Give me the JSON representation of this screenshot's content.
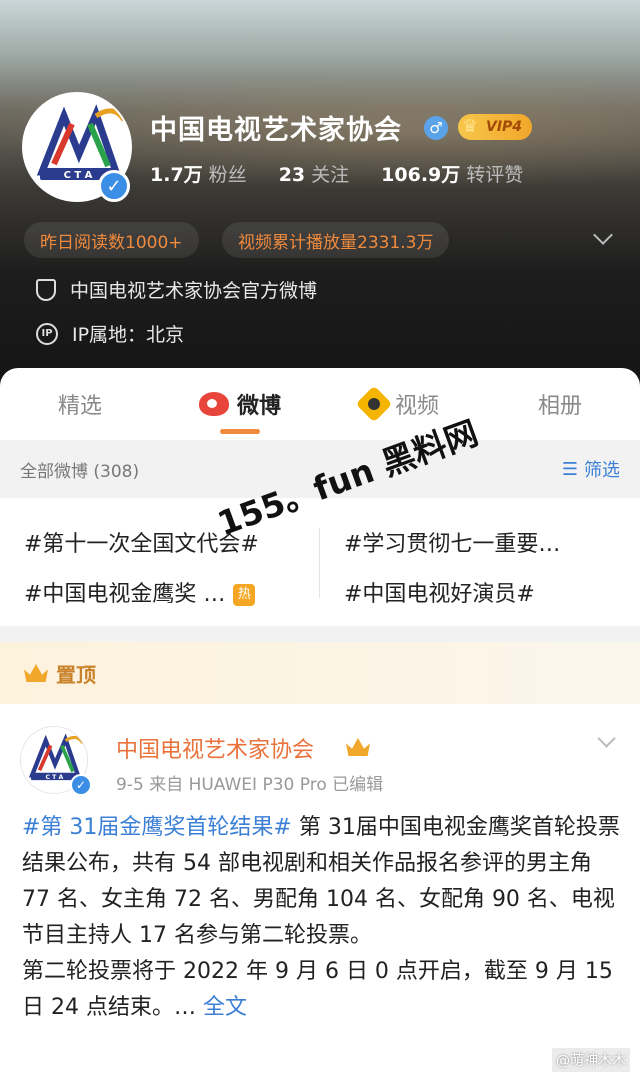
{
  "profile": {
    "name": "中国电视艺术家协会",
    "vip_label": "VIP4",
    "stats": [
      {
        "value": "1.7万",
        "label": "粉丝"
      },
      {
        "value": "23",
        "label": "关注"
      },
      {
        "value": "106.9万",
        "label": "转评赞"
      }
    ],
    "pills": [
      "昨日阅读数1000+",
      "视频累计播放量2331.3万"
    ],
    "description": "中国电视艺术家协会官方微博",
    "ip_label": "IP属地：北京",
    "ip_icon_text": "IP"
  },
  "tabs": [
    {
      "label": "精选"
    },
    {
      "label": "微博"
    },
    {
      "label": "视频"
    },
    {
      "label": "相册"
    }
  ],
  "filter": {
    "left": "全部微博 (308)",
    "right": "筛选"
  },
  "topics": [
    "#第十一次全国文代会#",
    "#学习贯彻七一重要…",
    "#中国电视金鹰奖 …",
    "#中国电视好演员#"
  ],
  "hot_badge": "热",
  "pinned_label": "置顶",
  "post": {
    "author": "中国电视艺术家协会",
    "meta": "9-5  来自 HUAWEI P30 Pro  已编辑",
    "hashtag": "#第 31届金鹰奖首轮结果#",
    "para1": " 第 31届中国电视金鹰奖首轮投票结果公布，共有 54 部电视剧和相关作品报名参评的男主角 77 名、女主角 72 名、男配角 104 名、女配角 90 名、电视节目主持人 17 名参与第二轮投票。",
    "para2": "第二轮投票将于 2022 年 9 月 6 日 0 点开启，截至 9 月 15 日 24 点结束。… ",
    "more_link": "全文"
  },
  "watermark": "155。fun 黑料网",
  "corner_watermark": "@萌神木木",
  "colors": {
    "accent_orange": "#f08a3d",
    "link_blue": "#3b7fd6",
    "author_orange": "#e8723a",
    "verify_blue": "#3a8ee6"
  }
}
